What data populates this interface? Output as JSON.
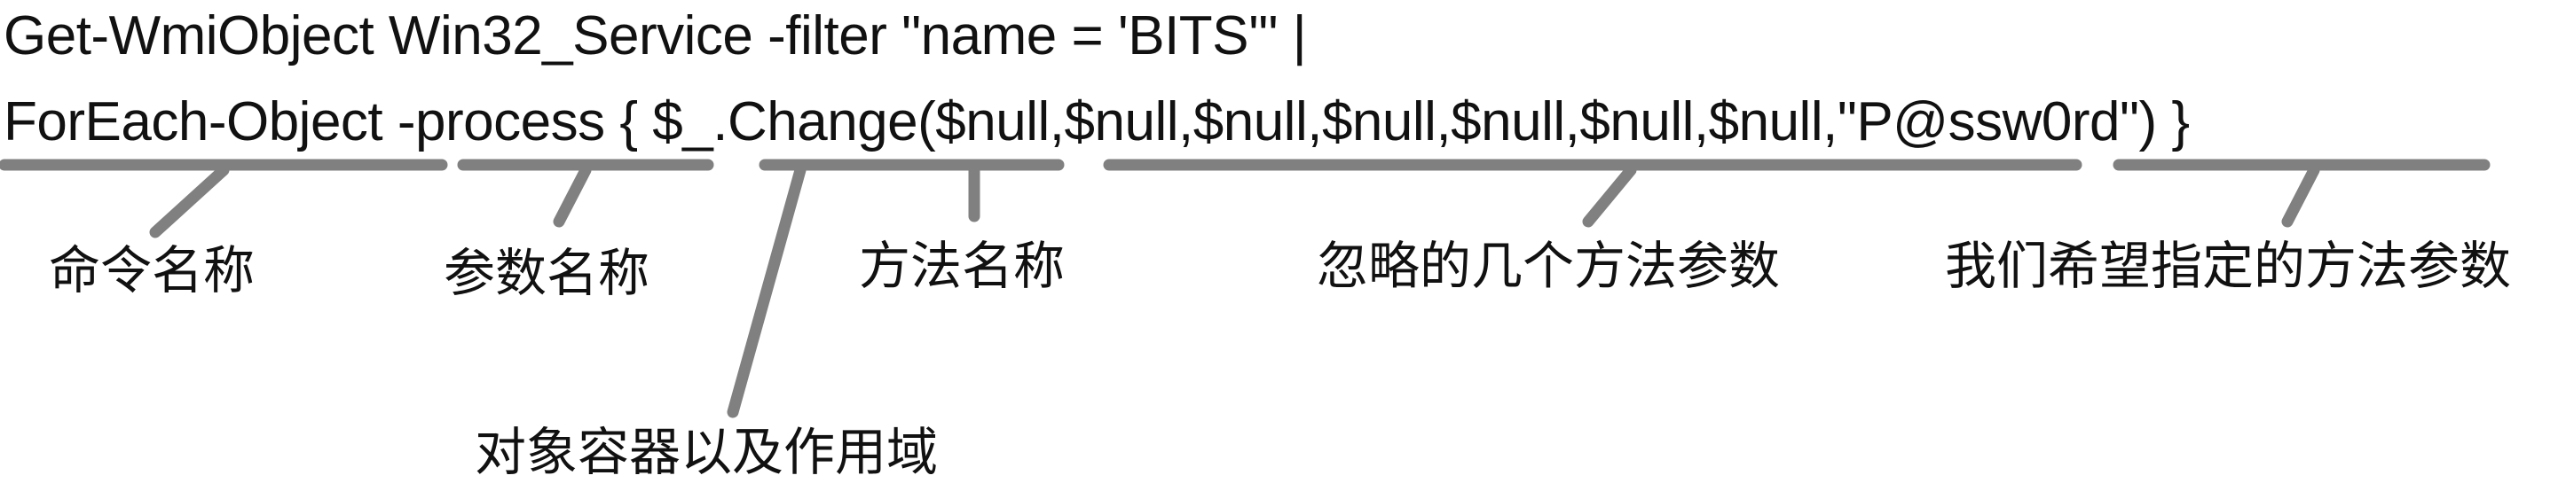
{
  "code": {
    "line1": "Get-WmiObject Win32_Service -filter \"name = 'BITS'\" |",
    "line2": "ForEach-Object -process { $_.Change($null,$null,$null,$null,$null,$null,$null,\"P@ssw0rd\") }"
  },
  "annotations": {
    "command_name": "命令名称",
    "parameter_name": "参数名称",
    "method_name": "方法名称",
    "ignored_method_params": "忽略的几个方法参数",
    "desired_method_param": "我们希望指定的方法参数",
    "object_container_scope": "对象容器以及作用域"
  },
  "colors": {
    "annotation_line": "#808080",
    "text": "#111111",
    "background": "#ffffff"
  }
}
